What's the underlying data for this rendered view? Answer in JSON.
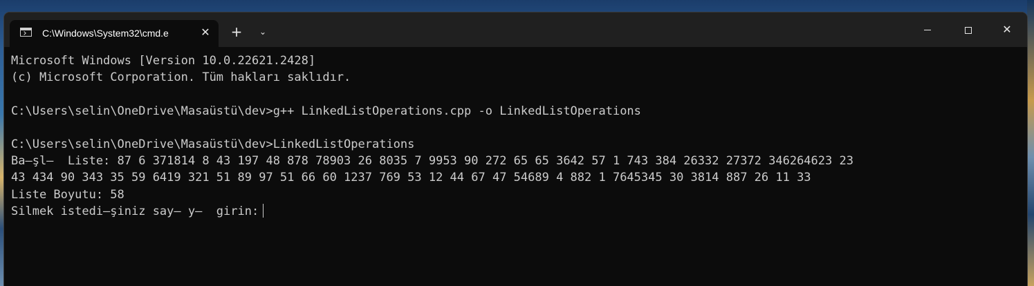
{
  "window": {
    "tab_title": "C:\\Windows\\System32\\cmd.e",
    "tab_icon": "console-icon",
    "close_tab_glyph": "✕",
    "new_tab_glyph": "+",
    "dropdown_glyph": "⌄",
    "minimize_glyph": "",
    "maximize_glyph": "",
    "close_window_glyph": "✕"
  },
  "console": {
    "lines": [
      "Microsoft Windows [Version 10.0.22621.2428]",
      "(c) Microsoft Corporation. Tüm hakları saklıdır.",
      "",
      "C:\\Users\\selin\\OneDrive\\Masaüstü\\dev>g++ LinkedListOperations.cpp -o LinkedListOperations",
      "",
      "C:\\Users\\selin\\OneDrive\\Masaüstü\\dev>LinkedListOperations",
      "Ba—şl—  Liste: 87 6 371814 8 43 197 48 878 78903 26 8035 7 9953 90 272 65 65 3642 57 1 743 384 26332 27372 346264623 23",
      "43 434 90 343 35 59 6419 321 51 89 97 51 66 60 1237 769 53 12 44 67 47 54689 4 882 1 7645345 30 3814 887 26 11 33",
      "Liste Boyutu: 58",
      "Silmek istedi—şiniz say— y—  girin:"
    ]
  },
  "colors": {
    "console_background": "#0c0c0c",
    "console_text": "#cccccc",
    "titlebar": "#202020"
  }
}
